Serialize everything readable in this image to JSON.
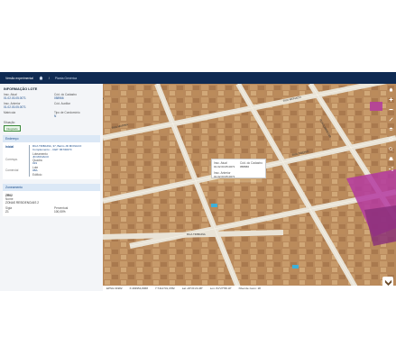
{
  "navbar": {
    "brand": "Versão experimental",
    "home_icon": "home-icon",
    "breadcrumb": "Planta Genérica"
  },
  "panel": {
    "title": "INFORMAÇÃO LOTE",
    "fields": [
      {
        "label": "Insc. Atual",
        "value": "01.02.03.05.0071"
      },
      {
        "label": "Cód. do Cadastro",
        "value": "058966"
      },
      {
        "label": "Insc. Anterior",
        "value": "01.02.03.05.0071"
      },
      {
        "label": "Cód. Auxiliar",
        "value": ""
      },
      {
        "label": "Matrícula",
        "value": ""
      },
      {
        "label": "Tipo de Condomínio",
        "value": "N"
      }
    ],
    "situation_label": "Situação",
    "situation_value": "Integrado",
    "endereco_title": "Endereço",
    "endereco": {
      "rows": [
        {
          "key": "Inicial",
          "active": true
        },
        {
          "key": "Correspo.",
          "active": false
        },
        {
          "key": "Comercial",
          "active": false
        }
      ],
      "lines": [
        {
          "label": "",
          "value": "RUA TRIBAINA, 37, Bairro JD MONACO Complemento: - CEP: 86730070"
        },
        {
          "label": "Loteamento",
          "value": "JD MONACO"
        },
        {
          "label": "Quadra",
          "value": "019"
        },
        {
          "label": "Lote",
          "value": "0BA"
        },
        {
          "label": "Edifício",
          "value": ""
        }
      ]
    },
    "zoneamento_title": "Zoneamento",
    "zoneamento": {
      "code": "ZR02",
      "name_label": "Nome",
      "name_value": "ZONAS RESIDENCIAIS 2",
      "code_label": "Sigla",
      "code_value": "Z1",
      "percent_label": "Percentual",
      "percent_value": "100,00%"
    }
  },
  "map": {
    "streets": [
      "RUA MARINA",
      "RUA TIBÉRIO",
      "RUA TRIBAINA",
      "RUA CABREÚVA",
      "RUA MONACO"
    ],
    "popup": {
      "rows": [
        {
          "label": "Insc. Atual",
          "value": "01.02.03.05.0071"
        },
        {
          "label": "Cód. do Cadastro",
          "value": "058966"
        },
        {
          "label": "Insc. Anterior",
          "value": "01.02.03.05.0071"
        }
      ]
    },
    "coords": [
      "EPSG:31982",
      "X:493954,8368",
      "Y:7414731,3782",
      "Lat:-23°21'24.48\"",
      "Lon:-51°27'58.10\"",
      "Nível de zoom: 18"
    ],
    "toolbar_icons": [
      "home-icon",
      "zoom-in-icon",
      "zoom-out-icon",
      "measure-icon",
      "layers-icon",
      "print-icon",
      "share-icon",
      "info-icon",
      "search-icon"
    ]
  },
  "colors": {
    "navbar": "#0f2a52",
    "accent": "#1b4c8a",
    "section": "#dbe8f6"
  }
}
